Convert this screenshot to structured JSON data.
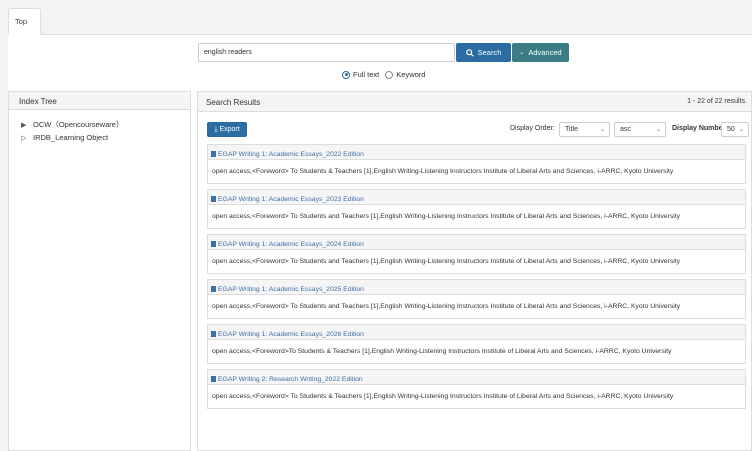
{
  "tabs": [
    {
      "label": "Top"
    }
  ],
  "search": {
    "value": "english readers",
    "search_label": "Search",
    "advanced_label": "Advanced",
    "options": [
      "Full text",
      "Keyword"
    ],
    "selected": "Full text"
  },
  "index_tree": {
    "title": "Index Tree",
    "items": [
      {
        "label": "OCW（Opencourseware）",
        "arrow": "▶"
      },
      {
        "label": "IRDB_Learning Object",
        "arrow": "▷"
      }
    ]
  },
  "results": {
    "title": "Search Results",
    "count_text": "1 - 22 of 22 results.",
    "export_label": "Export",
    "display_order_label": "Display Order:",
    "order_field": "Title",
    "order_dir": "asc",
    "display_number_label": "Display Number",
    "display_number": "50",
    "items": [
      {
        "title": "EGAP Writing 1: Academic Essays_2022 Edition",
        "desc": "open access,<Foreword> To Students & Teachers [1],English Writing-Listening Instructors Institute of Liberal Arts and Sciences, i-ARRC, Kyoto University"
      },
      {
        "title": "EGAP Writing 1: Academic Essays_2023 Edition",
        "desc": "open access,<Foreword> To Students and Teachers [1],English Writing-Listening Instructors Institute of Liberal Arts and Sciences, i-ARRC, Kyoto University"
      },
      {
        "title": "EGAP Writing 1: Academic Essays_2024 Edition",
        "desc": "open access,<Foreword> To Students and Teachers [1],English Writing-Listening Instructors Institute of Liberal Arts and Sciences, i-ARRC, Kyoto University"
      },
      {
        "title": "EGAP Writing 1: Academic Essays_2025 Edition",
        "desc": "open access,<Foreword> To Students and Teachers [1],English Writing-Listening Instructors Institute of Liberal Arts and Sciences, i-ARRC, Kyoto University"
      },
      {
        "title": "EGAP Writing 1: Academic Essays_2026 Edition",
        "desc": "open access,<Foreword>To Students & Teachers [1],English Writing-Listening Instructors Institute of Liberal Arts and Sciences, i-ARRC, Kyoto University"
      },
      {
        "title": "EGAP Writing 2: Research Writing_2022 Edition",
        "desc": "open access,<Foreword> To Students & Teachers [1],English Writing-Listening Instructors Institute of Liberal Arts and Sciences, i-ARRC, Kyoto University"
      }
    ]
  },
  "colors": {
    "primary": "#2b6ca3",
    "advanced": "#3a7d85",
    "link": "#3c6fa8"
  }
}
